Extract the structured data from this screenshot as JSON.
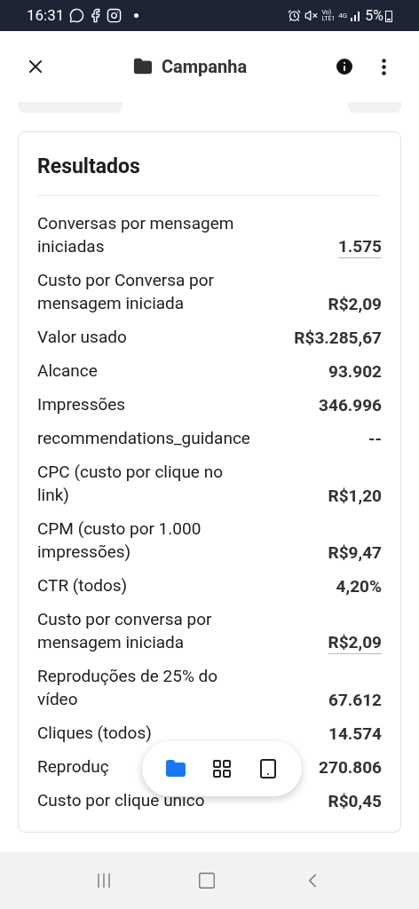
{
  "status_bar": {
    "time": "16:31",
    "network_top": "Vo)",
    "network_bottom": "LTE1",
    "data_type": "4G",
    "battery": "5%"
  },
  "header": {
    "title": "Campanha"
  },
  "card": {
    "title": "Resultados",
    "rows": [
      {
        "label": "Conversas por mensagem iniciadas",
        "value": "1.575",
        "underlined": true
      },
      {
        "label": "Custo por Conversa por mensagem iniciada",
        "value": "R$2,09",
        "underlined": false
      },
      {
        "label": "Valor usado",
        "value": "R$3.285,67",
        "underlined": false
      },
      {
        "label": "Alcance",
        "value": "93.902",
        "underlined": false
      },
      {
        "label": "Impressões",
        "value": "346.996",
        "underlined": false
      },
      {
        "label": "recommendations_guidance",
        "value": "--",
        "underlined": false
      },
      {
        "label": "CPC (custo por clique no link)",
        "value": "R$1,20",
        "underlined": false
      },
      {
        "label": "CPM (custo por 1.000 impressões)",
        "value": "R$9,47",
        "underlined": false
      },
      {
        "label": "CTR (todos)",
        "value": "4,20%",
        "underlined": false
      },
      {
        "label": "Custo por conversa por mensagem iniciada",
        "value": "R$2,09",
        "underlined": true
      },
      {
        "label": "Reproduções de 25% do vídeo",
        "value": "67.612",
        "underlined": false
      },
      {
        "label": "Cliques (todos)",
        "value": "14.574",
        "underlined": false
      },
      {
        "label": "Reproduç",
        "value": "270.806",
        "underlined": false
      },
      {
        "label": "Custo por clique único",
        "value": "R$0,45",
        "underlined": false
      }
    ]
  },
  "floating_bar": {
    "items": [
      {
        "kind": "folder",
        "selected": true
      },
      {
        "kind": "grid",
        "selected": false
      },
      {
        "kind": "tablet",
        "selected": false
      }
    ]
  }
}
